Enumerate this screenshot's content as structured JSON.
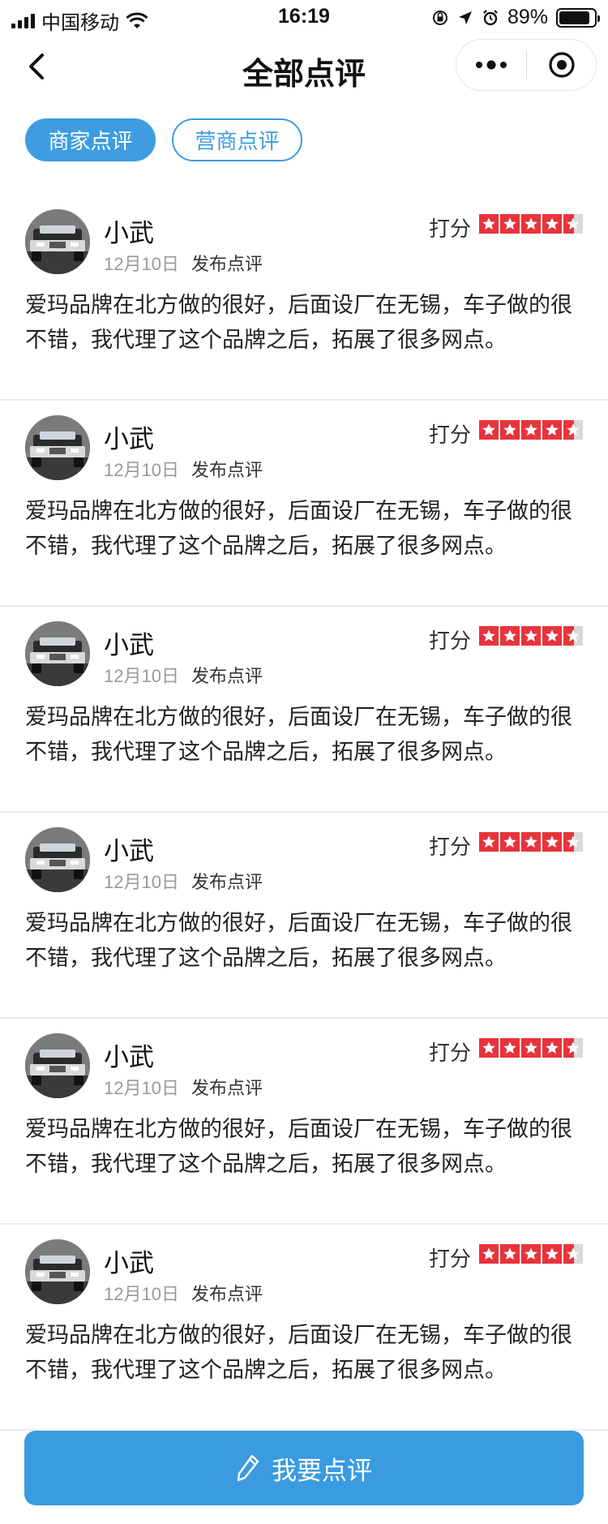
{
  "status_bar": {
    "carrier": "中国移动",
    "time": "16:19",
    "battery": "89%",
    "battery_level": 0.89,
    "icons": [
      "signal-icon",
      "wifi-icon",
      "orientation-lock-icon",
      "location-icon",
      "alarm-icon",
      "battery-icon"
    ]
  },
  "nav": {
    "back_icon": "chevron-left-icon",
    "title": "全部点评",
    "menu_icon": "more-dots-icon",
    "close_icon": "target-icon"
  },
  "tabs": [
    {
      "label": "商家点评",
      "active": true
    },
    {
      "label": "营商点评",
      "active": false
    }
  ],
  "reviews": [
    {
      "name": "小武",
      "date": "12月10日",
      "action": "发布点评",
      "score_label": "打分",
      "rating": 4.5,
      "content": "爱玛品牌在北方做的很好，后面设厂在无锡，车子做的很不错，我代理了这个品牌之后，拓展了很多网点。"
    },
    {
      "name": "小武",
      "date": "12月10日",
      "action": "发布点评",
      "score_label": "打分",
      "rating": 4.5,
      "content": "爱玛品牌在北方做的很好，后面设厂在无锡，车子做的很不错，我代理了这个品牌之后，拓展了很多网点。"
    },
    {
      "name": "小武",
      "date": "12月10日",
      "action": "发布点评",
      "score_label": "打分",
      "rating": 4.5,
      "content": "爱玛品牌在北方做的很好，后面设厂在无锡，车子做的很不错，我代理了这个品牌之后，拓展了很多网点。"
    },
    {
      "name": "小武",
      "date": "12月10日",
      "action": "发布点评",
      "score_label": "打分",
      "rating": 4.5,
      "content": "爱玛品牌在北方做的很好，后面设厂在无锡，车子做的很不错，我代理了这个品牌之后，拓展了很多网点。"
    },
    {
      "name": "小武",
      "date": "12月10日",
      "action": "发布点评",
      "score_label": "打分",
      "rating": 4.5,
      "content": "爱玛品牌在北方做的很好，后面设厂在无锡，车子做的很不错，我代理了这个品牌之后，拓展了很多网点。"
    },
    {
      "name": "小武",
      "date": "12月10日",
      "action": "发布点评",
      "score_label": "打分",
      "rating": 4.5,
      "content": "爱玛品牌在北方做的很好，后面设厂在无锡，车子做的很不错，我代理了这个品牌之后，拓展了很多网点。"
    }
  ],
  "bottom_button": {
    "label": "我要点评",
    "icon": "pencil-icon"
  },
  "colors": {
    "accent": "#3d9de0",
    "star": "#e8333b"
  }
}
